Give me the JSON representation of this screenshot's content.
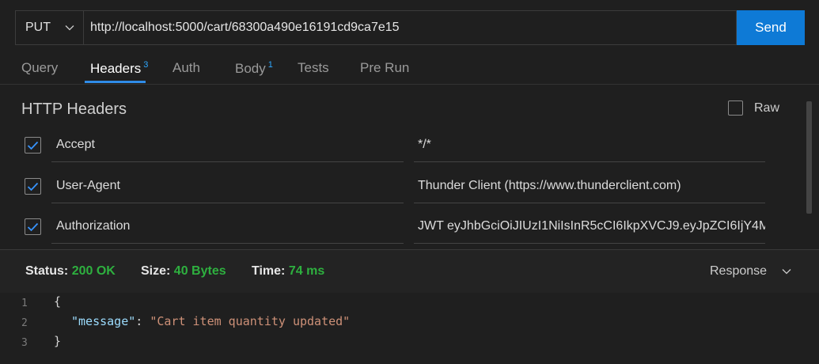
{
  "request": {
    "method": "PUT",
    "url": "http://localhost:5000/cart/68300a490e16191cd9ca7e15",
    "send_label": "Send"
  },
  "tabs": [
    {
      "label": "Query",
      "badge": ""
    },
    {
      "label": "Headers",
      "badge": "3",
      "active": true
    },
    {
      "label": "Auth",
      "badge": ""
    },
    {
      "label": "Body",
      "badge": "1"
    },
    {
      "label": "Tests",
      "badge": ""
    },
    {
      "label": "Pre Run",
      "badge": ""
    }
  ],
  "headers_section": {
    "title": "HTTP Headers",
    "raw_label": "Raw",
    "raw_checked": false,
    "rows": [
      {
        "checked": true,
        "key": "Accept",
        "value": "*/*"
      },
      {
        "checked": true,
        "key": "User-Agent",
        "value": "Thunder Client (https://www.thunderclient.com)"
      },
      {
        "checked": true,
        "key": "Authorization",
        "value": "JWT eyJhbGciOiJIUzI1NiIsInR5cCI6IkpXVCJ9.eyJpZCI6IjY4M"
      }
    ]
  },
  "response": {
    "status_label": "Status:",
    "status_value": "200 OK",
    "size_label": "Size:",
    "size_value": "40 Bytes",
    "time_label": "Time:",
    "time_value": "74 ms",
    "view_label": "Response",
    "lines": [
      {
        "n": "1",
        "open": "{"
      },
      {
        "n": "2",
        "key": "\"message\"",
        "sep": ": ",
        "value": "\"Cart item quantity updated\""
      },
      {
        "n": "3",
        "close": "}"
      }
    ]
  },
  "colors": {
    "accent": "#0e7ad6",
    "tab_badge": "#2ea8ff",
    "status_ok": "#2eb03f",
    "json_key": "#9cdcfe",
    "json_string": "#ce9178"
  }
}
